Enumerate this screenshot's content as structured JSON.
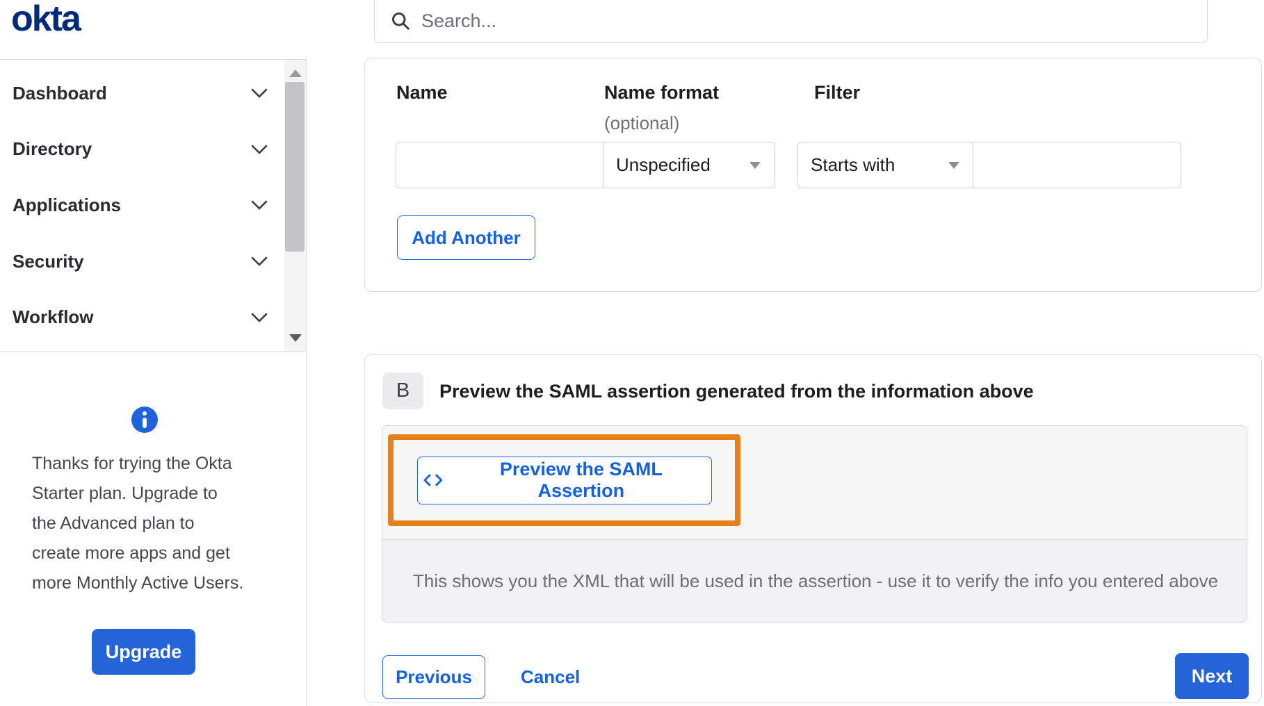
{
  "brand": {
    "logo_text": "okta"
  },
  "search": {
    "placeholder": "Search..."
  },
  "sidebar": {
    "items": [
      {
        "label": "Dashboard"
      },
      {
        "label": "Directory"
      },
      {
        "label": "Applications"
      },
      {
        "label": "Security"
      },
      {
        "label": "Workflow"
      }
    ],
    "upgrade": {
      "message": [
        "Thanks for trying the Okta",
        "Starter plan. Upgrade to",
        "the Advanced plan to",
        "create more apps and get",
        "more Monthly Active Users."
      ],
      "button_label": "Upgrade"
    }
  },
  "attribute_form": {
    "columns": {
      "name_label": "Name",
      "format_label": "Name format",
      "format_sublabel": "(optional)",
      "filter_label": "Filter"
    },
    "name_value": "",
    "name_format_selected": "Unspecified",
    "filter_type_selected": "Starts with",
    "filter_value": "",
    "add_another_label": "Add Another"
  },
  "preview_section": {
    "badge": "B",
    "title": "Preview the SAML assertion generated from the information above",
    "preview_button_label": "Preview the SAML Assertion",
    "description": "This shows you the XML that will be used in the assertion - use it to verify the info you entered above"
  },
  "footer": {
    "previous_label": "Previous",
    "cancel_label": "Cancel",
    "next_label": "Next"
  },
  "colors": {
    "brand_navy": "#00297a",
    "accent_blue": "#1662dd",
    "button_blue": "#2563d9",
    "highlight_orange": "#e5801c",
    "border_gray": "#dcdcde",
    "muted_text": "#6e6e78"
  }
}
